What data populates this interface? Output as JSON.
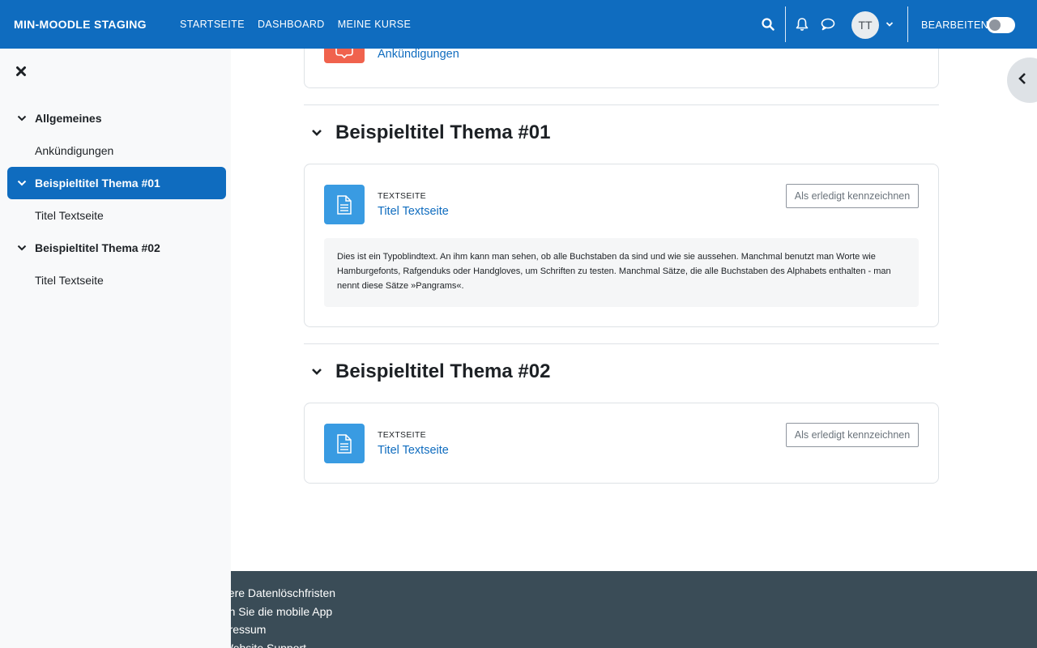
{
  "navbar": {
    "brand": "MIN-MOODLE STAGING",
    "links": [
      "STARTSEITE",
      "DASHBOARD",
      "MEINE KURSE"
    ],
    "avatar_initials": "TT",
    "edit_mode_label": "BEARBEITEN",
    "edit_mode_on": false
  },
  "drawer": {
    "sections": [
      {
        "title": "Allgemeines",
        "active": false,
        "items": [
          "Ankündigungen"
        ]
      },
      {
        "title": "Beispieltitel Thema #01",
        "active": true,
        "items": [
          "Titel Textseite"
        ]
      },
      {
        "title": "Beispieltitel Thema #02",
        "active": false,
        "items": [
          "Titel Textseite"
        ]
      }
    ]
  },
  "main": {
    "top_activity": {
      "name": "Ankündigungen"
    },
    "sections": [
      {
        "title": "Beispieltitel Thema #01",
        "activity": {
          "type": "TEXTSEITE",
          "name": "Titel Textseite",
          "completion_button": "Als erledigt kennzeichnen",
          "description": "Dies ist ein Typoblindtext. An ihm kann man sehen, ob alle Buchstaben da sind und wie sie aussehen. Manchmal benutzt man Worte wie Hamburgefonts, Rafgenduks oder Handgloves, um Schriften zu testen. Manchmal Sätze, die alle Buchstaben des Alphabets enthalten - man nennt diese Sätze »Pangrams«."
        }
      },
      {
        "title": "Beispieltitel Thema #02",
        "activity": {
          "type": "TEXTSEITE",
          "name": "Titel Textseite",
          "completion_button": "Als erledigt kennzeichnen"
        }
      }
    ]
  },
  "footer": {
    "links": [
      "nsere Datenlöschfristen",
      "den Sie die mobile App",
      "npressum",
      ". Website Support"
    ]
  },
  "colors": {
    "primary": "#0f6cbf",
    "forum_icon": "#f0624d",
    "page_icon": "#399be2",
    "footer_bg": "#3a4c57"
  }
}
